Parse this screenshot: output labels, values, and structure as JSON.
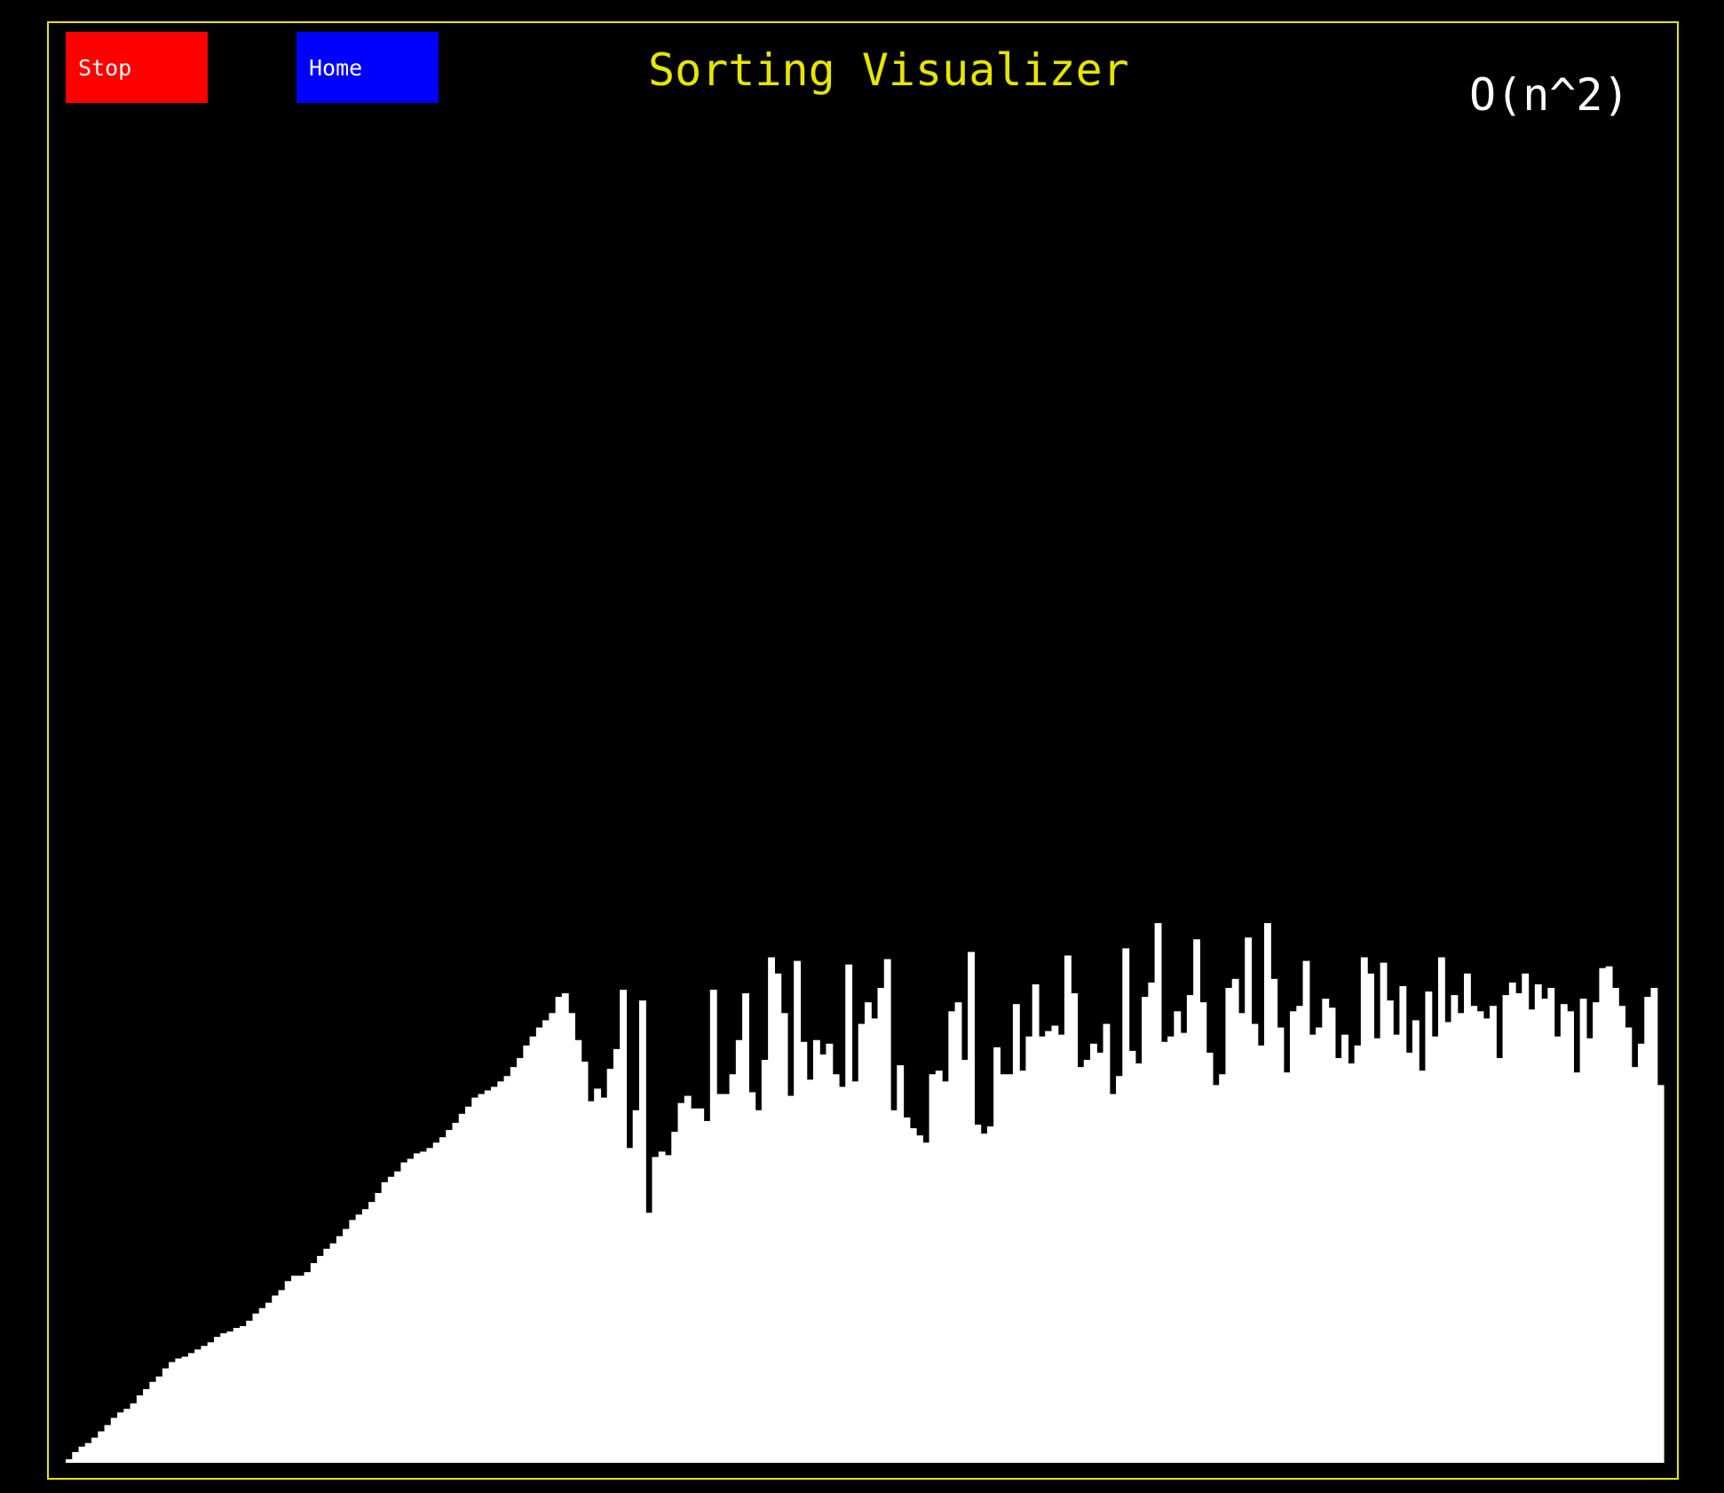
{
  "app": {
    "title": "Sorting Visualizer",
    "complexity": "O(n^2)"
  },
  "buttons": {
    "stop_label": "Stop",
    "home_label": "Home"
  },
  "colors": {
    "background": "#000000",
    "frame": "#e6e600",
    "title": "#e6e600",
    "stop_button": "#ff0000",
    "home_button": "#0000ff",
    "bar": "#ffffff",
    "complexity_text": "#ffffff"
  },
  "chart_data": {
    "type": "bar",
    "description_free": true,
    "ylim": [
      0,
      600
    ],
    "values": [
      4,
      12,
      18,
      22,
      28,
      35,
      42,
      50,
      56,
      60,
      66,
      75,
      82,
      90,
      96,
      105,
      112,
      116,
      118,
      122,
      126,
      130,
      134,
      140,
      144,
      146,
      150,
      152,
      158,
      166,
      172,
      178,
      186,
      192,
      202,
      208,
      208,
      212,
      222,
      230,
      238,
      244,
      252,
      260,
      270,
      276,
      282,
      290,
      300,
      312,
      318,
      324,
      334,
      338,
      344,
      346,
      350,
      356,
      362,
      370,
      378,
      388,
      396,
      406,
      410,
      414,
      418,
      424,
      430,
      440,
      450,
      464,
      474,
      484,
      492,
      500,
      518,
      522,
      500,
      470,
      446,
      402,
      416,
      406,
      438,
      460,
      526,
      350,
      392,
      514,
      278,
      340,
      346,
      342,
      368,
      400,
      408,
      394,
      394,
      380,
      526,
      410,
      410,
      432,
      470,
      522,
      412,
      392,
      448,
      562,
      544,
      500,
      408,
      558,
      468,
      426,
      470,
      454,
      466,
      432,
      418,
      554,
      424,
      488,
      512,
      494,
      528,
      560,
      392,
      442,
      384,
      372,
      364,
      356,
      432,
      436,
      424,
      502,
      512,
      448,
      568,
      376,
      366,
      374,
      462,
      432,
      432,
      510,
      436,
      474,
      532,
      474,
      480,
      486,
      476,
      564,
      522,
      440,
      448,
      466,
      456,
      488,
      410,
      430,
      572,
      458,
      444,
      518,
      534,
      600,
      468,
      474,
      502,
      478,
      520,
      582,
      512,
      456,
      420,
      432,
      528,
      538,
      500,
      584,
      488,
      464,
      600,
      538,
      484,
      434,
      502,
      508,
      558,
      476,
      484,
      516,
      506,
      450,
      476,
      444,
      464,
      562,
      544,
      472,
      556,
      514,
      476,
      530,
      456,
      492,
      436,
      524,
      474,
      562,
      490,
      520,
      500,
      544,
      508,
      502,
      494,
      508,
      450,
      520,
      534,
      522,
      544,
      504,
      532,
      516,
      528,
      474,
      510,
      502,
      434,
      516,
      472,
      512,
      550,
      552,
      528,
      508,
      484,
      440,
      466,
      518,
      528,
      420
    ]
  }
}
